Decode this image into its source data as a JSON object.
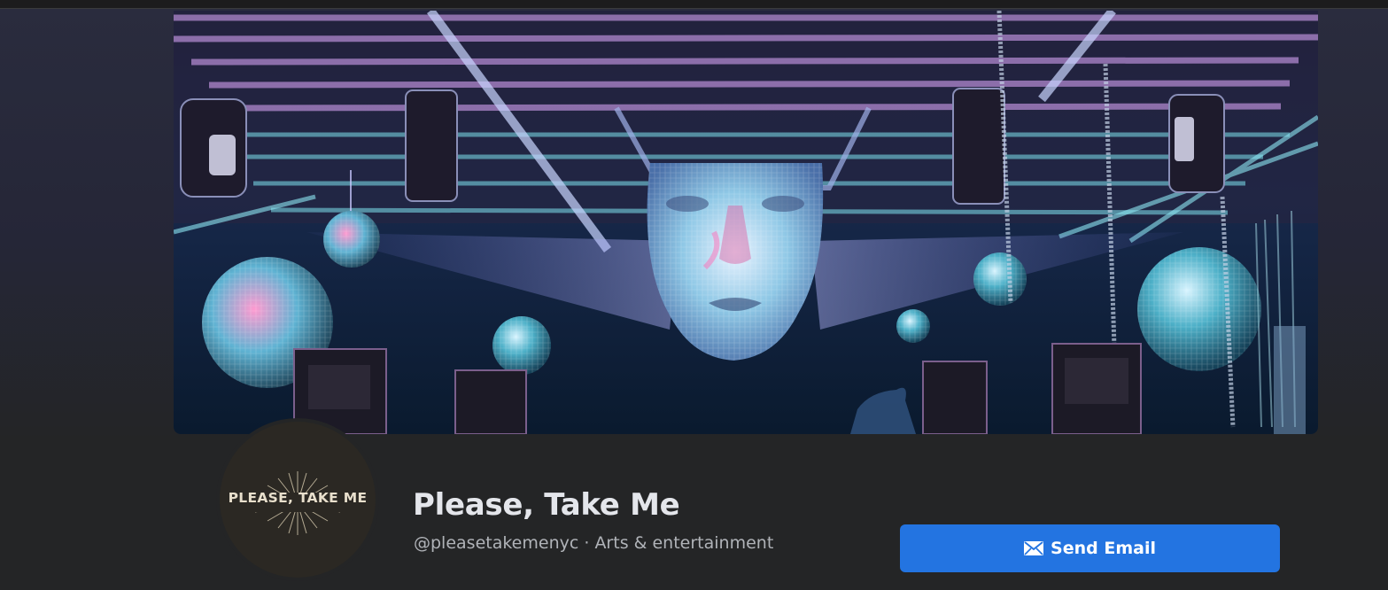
{
  "page": {
    "name": "Please, Take Me",
    "handle": "@pleasetakemenyc",
    "separator": " · ",
    "category": "Arts & entertainment",
    "avatar_text": "PLEASE, TAKE ME"
  },
  "actions": {
    "send_email_label": "Send Email",
    "send_email_icon": "envelope-icon"
  },
  "colors": {
    "background": "#242526",
    "primary_text": "#e4e6eb",
    "secondary_text": "#b0b3b8",
    "accent": "#2374e1"
  }
}
